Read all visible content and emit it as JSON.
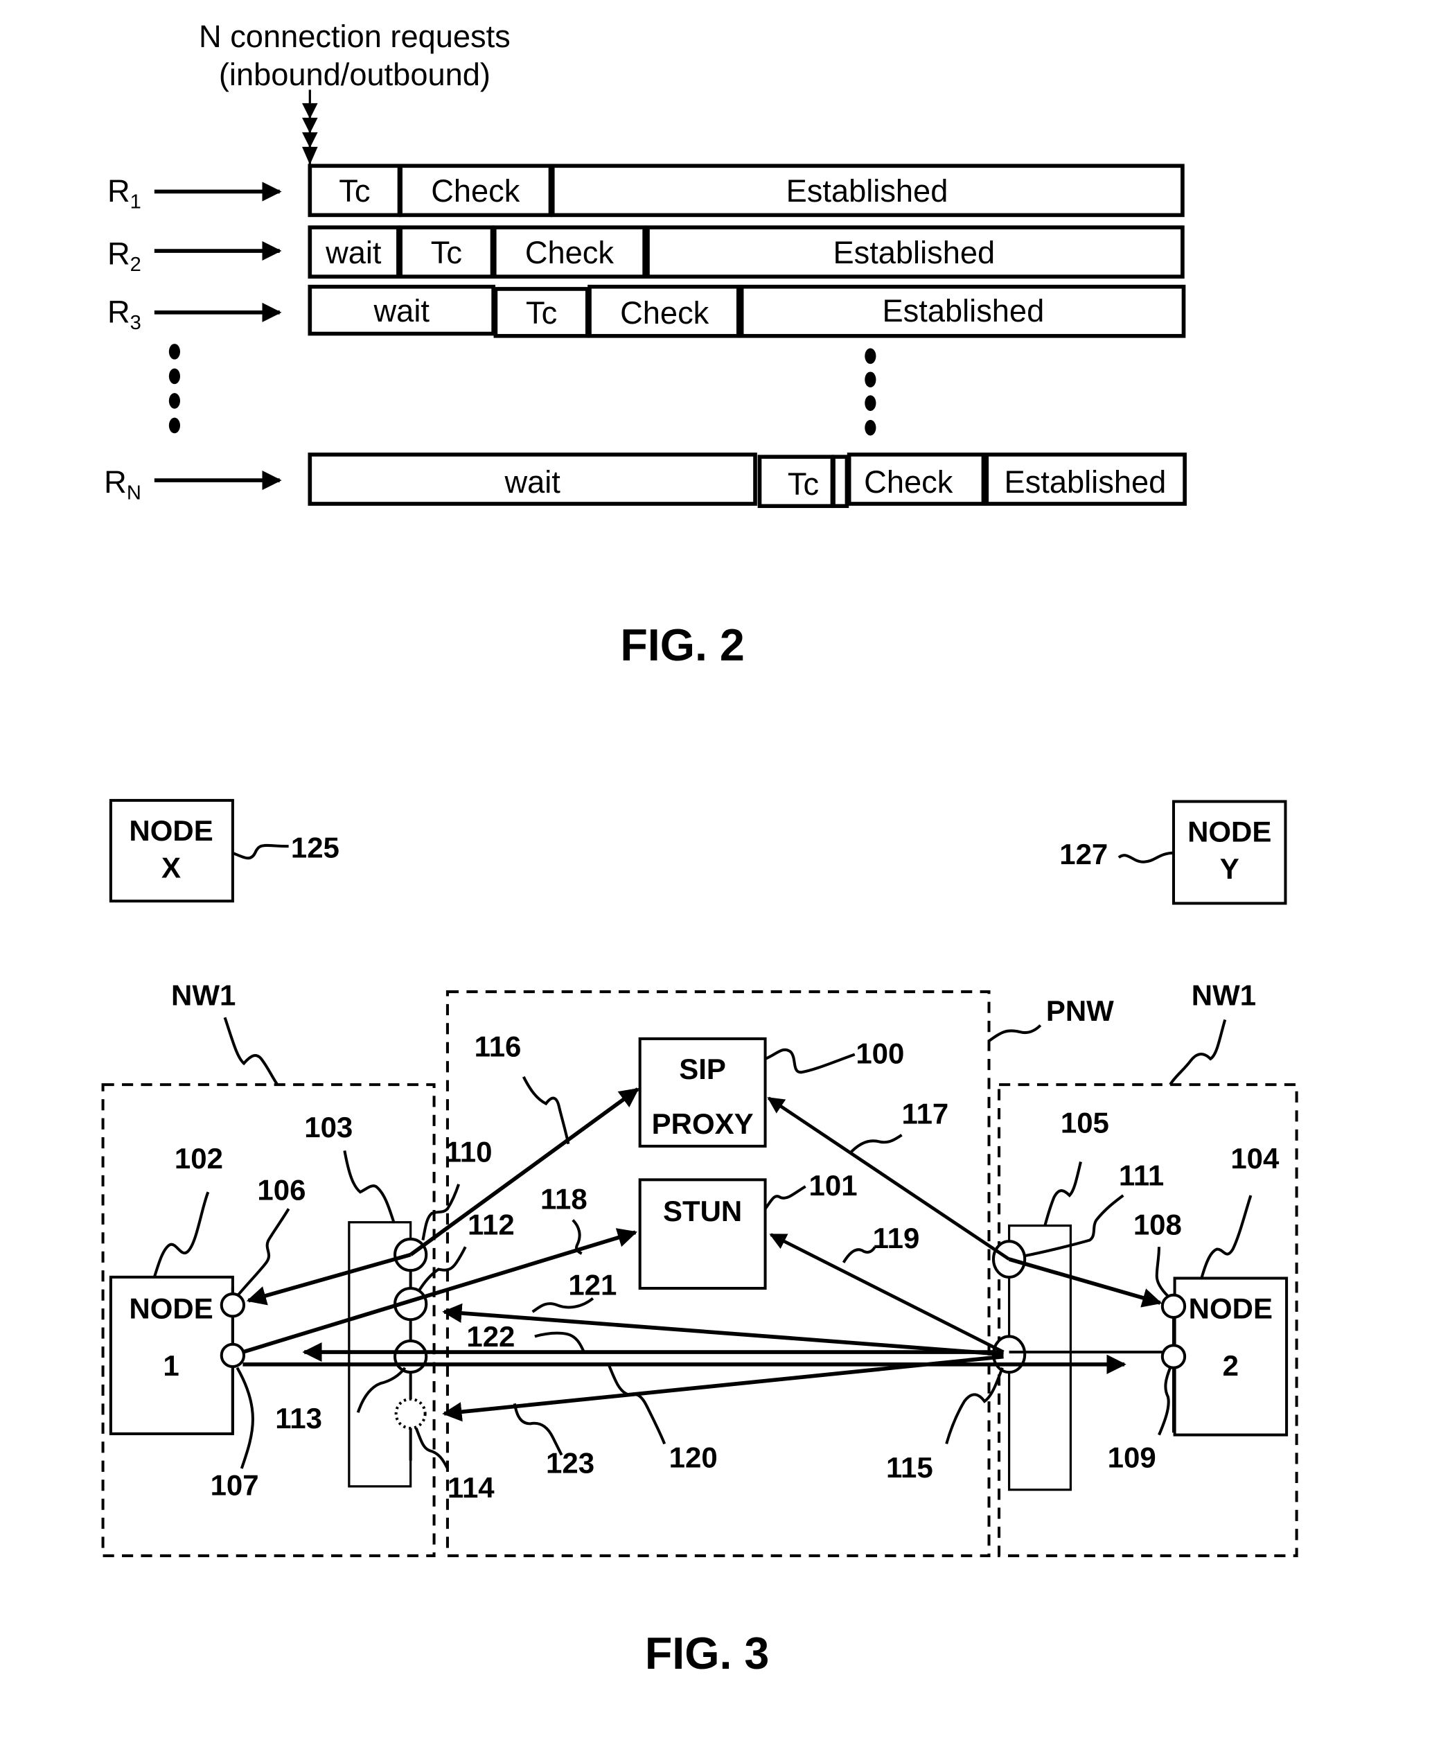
{
  "fig2": {
    "caption": "FIG. 2",
    "header_line1": "N connection requests",
    "header_line2": "(inbound/outbound)",
    "rows": [
      {
        "label": "R",
        "sub": "1",
        "segments": [
          "Tc",
          "Check",
          "Established"
        ]
      },
      {
        "label": "R",
        "sub": "2",
        "segments": [
          "wait",
          "Tc",
          "Check",
          "Established"
        ]
      },
      {
        "label": "R",
        "sub": "3",
        "segments": [
          "wait",
          "Tc",
          "Check",
          "Established"
        ]
      },
      {
        "label": "R",
        "sub": "N",
        "segments": [
          "wait",
          "Tc",
          "Check",
          "Established"
        ]
      }
    ]
  },
  "fig3": {
    "caption": "FIG. 3",
    "node_x": {
      "line1": "NODE",
      "line2": "X",
      "ref": "125"
    },
    "node_y": {
      "line1": "NODE",
      "line2": "Y",
      "ref": "127"
    },
    "network_left": "NW1",
    "network_right": "NW1",
    "network_public": "PNW",
    "sip_proxy": {
      "line1": "SIP",
      "line2": "PROXY",
      "ref": "100"
    },
    "stun": {
      "line1": "STUN",
      "ref": "101"
    },
    "node1": {
      "line1": "NODE",
      "line2": "1",
      "ref": "102"
    },
    "node2": {
      "line1": "NODE",
      "line2": "2",
      "ref": "104"
    },
    "refs": {
      "r103": "103",
      "r105": "105",
      "r106": "106",
      "r107": "107",
      "r108": "108",
      "r109": "109",
      "r110": "110",
      "r111": "111",
      "r112": "112",
      "r113": "113",
      "r114": "114",
      "r115": "115",
      "r116": "116",
      "r117": "117",
      "r118": "118",
      "r119": "119",
      "r120": "120",
      "r121": "121",
      "r122": "122",
      "r123": "123"
    }
  }
}
